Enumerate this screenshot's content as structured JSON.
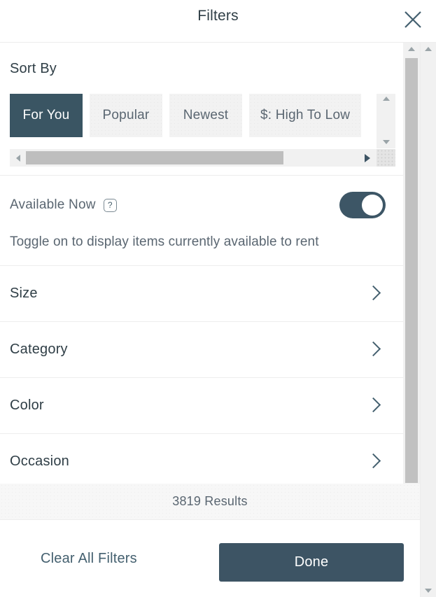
{
  "header": {
    "title": "Filters",
    "close_icon": "close-icon"
  },
  "sort": {
    "section_title": "Sort By",
    "options": [
      {
        "label": "For You",
        "selected": true
      },
      {
        "label": "Popular",
        "selected": false
      },
      {
        "label": "Newest",
        "selected": false
      },
      {
        "label": "$: High To Low",
        "selected": false
      }
    ]
  },
  "available_now": {
    "label": "Available Now",
    "help_icon": "help-icon",
    "help_glyph": "?",
    "toggle_state": "on",
    "description": "Toggle on to display items currently available to rent"
  },
  "filter_rows": [
    {
      "label": "Size",
      "chevron": "chevron-right-icon"
    },
    {
      "label": "Category",
      "chevron": "chevron-right-icon"
    },
    {
      "label": "Color",
      "chevron": "chevron-right-icon"
    },
    {
      "label": "Occasion",
      "chevron": "chevron-right-icon"
    }
  ],
  "results": {
    "text": "3819 Results",
    "count": 3819
  },
  "footer": {
    "clear_label": "Clear All Filters",
    "done_label": "Done"
  },
  "colors": {
    "accent": "#3d5464",
    "chip_selected_bg": "#3a5563",
    "chip_bg": "#f2f2f2",
    "text_primary": "#2f3e46",
    "text_secondary": "#5a6671",
    "divider": "#ededed",
    "scrollbar_track": "#f1f1f1",
    "scrollbar_thumb": "#c1c1c1"
  },
  "scrollbars": {
    "inner_vertical": "modal-content-scrollbar",
    "outer_vertical": "page-scrollbar",
    "sort_horizontal": "sort-options-horizontal-scrollbar",
    "sort_vertical": "sort-options-vertical-scrollbar"
  }
}
